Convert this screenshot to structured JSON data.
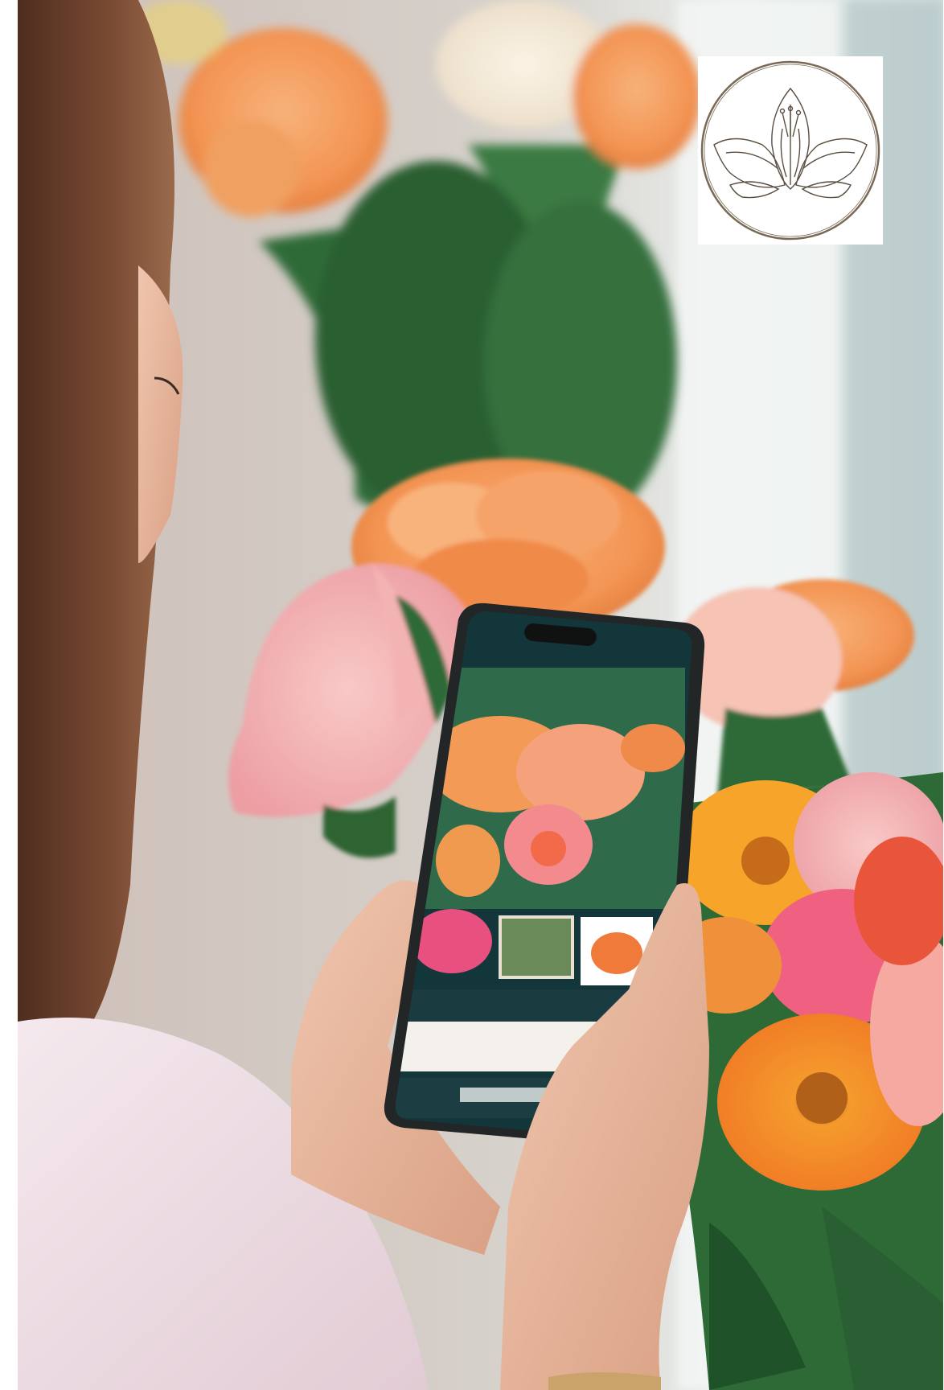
{
  "scene": {
    "description_label": "",
    "colors": {
      "wall": "#d9d2cd",
      "window_light": "#eef3f2",
      "foliage": "#2e6b3a",
      "peach_flower": "#f39a57",
      "pink_flower": "#f2a2a6",
      "orange_gerbera": "#f08a2c",
      "hair": "#6a3f2a",
      "skin": "#e8b79d",
      "sweater": "#f1e4ea",
      "phone_frame": "#222526",
      "phone_screen_bg": "#12353a",
      "logo_stroke": "#7a6a55"
    }
  },
  "phone": {
    "screen_texts": []
  },
  "logo": {
    "icon": "lily-flower-icon",
    "text": ""
  }
}
